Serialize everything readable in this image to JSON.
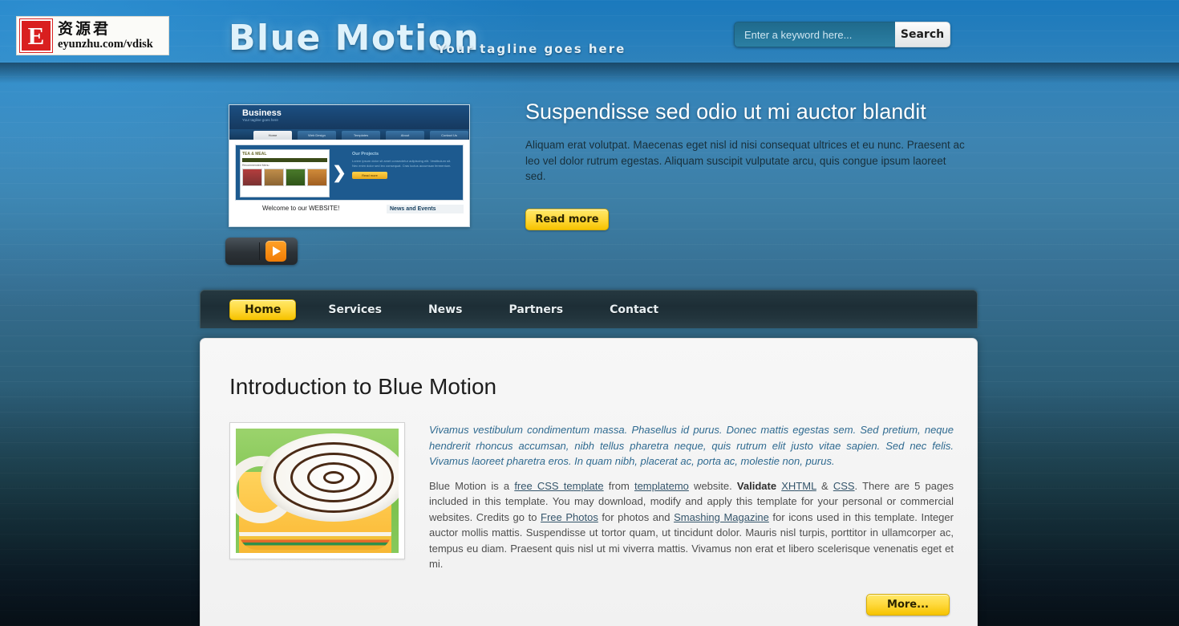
{
  "watermark": {
    "badge_letter": "E",
    "cn_text": "资源君",
    "url_text": "eyunzhu.com/vdisk"
  },
  "header": {
    "site_title": "Blue Motion",
    "tagline": "Your tagline goes here",
    "search": {
      "placeholder": "Enter a keyword here...",
      "value": "",
      "button_label": "Search"
    }
  },
  "slider": {
    "heading": "Suspendisse sed odio ut mi auctor blandit",
    "paragraph": "Aliquam erat volutpat. Maecenas eget nisl id nisi consequat ultrices et eu nunc. Praesent ac leo vel dolor rutrum egestas. Aliquam suscipit vulputate arcu, quis congue ipsum laoreet sed.",
    "read_more_label": "Read more",
    "preview": {
      "brand": "Business",
      "brand_sub": "Your tagline goes here",
      "tabs": [
        "Home",
        "Web Design",
        "Templates",
        "About",
        "Contact Us"
      ],
      "shot_title": "TEA & MEAL",
      "shot_caption": "Recommended Menu",
      "panel_title": "Our Projects",
      "panel_text": "Lorem ipsum dolor sit amet consectetur adipiscing elit. Vestibulum sit. Nec enim dolor sed leo consequat. Cras luctus accumsan fermentum.",
      "panel_button": "Read more",
      "welcome": "Welcome to our WEBSITE!",
      "news": "News and Events"
    },
    "play_icon": "play-icon"
  },
  "nav": {
    "items": [
      {
        "label": "Home",
        "active": true
      },
      {
        "label": "Services",
        "active": false
      },
      {
        "label": "News",
        "active": false
      },
      {
        "label": "Partners",
        "active": false
      },
      {
        "label": "Contact",
        "active": false
      }
    ]
  },
  "main": {
    "title": "Introduction to Blue Motion",
    "lead": "Vivamus vestibulum condimentum massa. Phasellus id purus. Donec mattis egestas sem. Sed pretium, neque hendrerit rhoncus accumsan, nibh tellus pharetra neque, quis rutrum elit justo vitae sapien. Sed nec felis. Vivamus laoreet pharetra eros. In quam nibh, placerat ac, porta ac, molestie non, purus.",
    "body": {
      "seg1": "Blue Motion is a ",
      "link1": "free CSS template",
      "seg2": " from ",
      "link2": "templatemo",
      "seg3": " website. ",
      "strong1": "Validate",
      "seg4": " ",
      "link3": "XHTML",
      "seg5": " & ",
      "link4": "CSS",
      "seg6": ". There are 5 pages included in this template. You may download, modify and apply this template for your personal or commercial websites. Credits go to ",
      "link5": "Free Photos",
      "seg7": " for photos and ",
      "link6": "Smashing Magazine",
      "seg8": " for icons used in this template. Integer auctor mollis mattis. Suspendisse ut tortor quam, ut tincidunt dolor. Mauris nisl turpis, porttitor in ullamcorper ac, tempus eu diam. Praesent quis nisl ut mi viverra mattis. Vivamus non erat et libero scelerisque venenatis eget et mi."
    },
    "more_label": "More...",
    "photo_alt": "coffee-cup-photo"
  },
  "colors": {
    "accent_yellow": "#ffd93e",
    "header_blue": "#2e82bb",
    "nav_dark": "#22343c",
    "link_blue": "#35556b",
    "lead_blue": "#2f6a90",
    "play_orange": "#f07c05"
  }
}
